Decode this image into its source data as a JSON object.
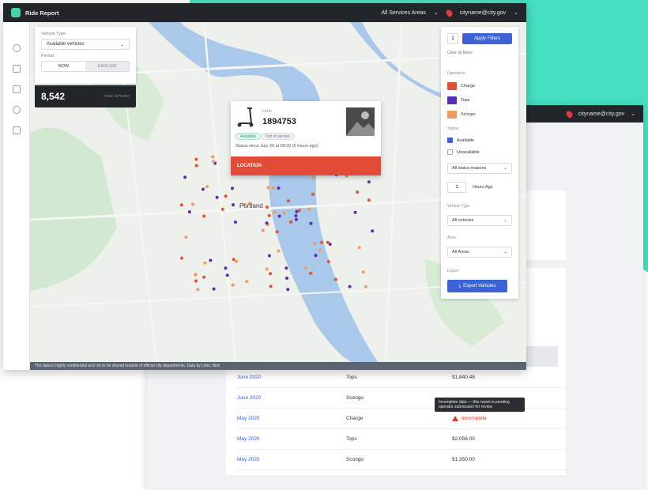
{
  "app": {
    "title": "Ride Report",
    "city_selector": "All Services Areas",
    "user_menu": "cityname@city.gov",
    "back_user_menu": "cityname@city.gov"
  },
  "filters": {
    "type_label": "Vehicle Type",
    "type_value": "Available vehicles",
    "period_label": "Period",
    "period_now": "NOW",
    "period_other": "EARLIER"
  },
  "count": {
    "value": "8,542",
    "caption": "total vehicles"
  },
  "popup": {
    "header": "Lime",
    "vehicle_id": "1894753",
    "chip_status": "Available",
    "chip_other": "Out of service",
    "meta": "Status since July 30 at 09:00 (5 hours ago)",
    "bar_text": "LOCATION"
  },
  "panel": {
    "count_input": "1",
    "apply_label": "Apply Filters",
    "clear_label": "Clear all filters",
    "operators_label": "Operators",
    "operators": [
      {
        "name": "Charge",
        "color": "#e0532e"
      },
      {
        "name": "Tops",
        "color": "#5b2db0"
      },
      {
        "name": "Scoogo",
        "color": "#f39a62"
      }
    ],
    "status_label": "Status",
    "status": [
      {
        "name": "Available",
        "checked": true
      },
      {
        "name": "Unavailable",
        "checked": false
      }
    ],
    "status_select": "All status reasons",
    "hours_value": "1",
    "hours_label": "Hours Ago",
    "vehicle_label": "Vehicle Type",
    "vehicle_select": "All vehicles",
    "area_label": "Area",
    "area_select": "All Areas",
    "export_label": "Export",
    "export_button": "Export Vehicles"
  },
  "map": {
    "city_label": "Portland",
    "footer": "The data is highly confidential and not to be shared outside of official city departments. Data by Lime, Bird"
  },
  "table": {
    "rows": [
      {
        "month": "June 2020",
        "operator": "Tops",
        "amount": "$1,840.48",
        "warn": false
      },
      {
        "month": "June 2020",
        "operator": "Scoogo",
        "amount": "",
        "warn": false
      },
      {
        "month": "May 2020",
        "operator": "Charge",
        "amount": "Incomplete",
        "warn": true
      },
      {
        "month": "May 2020",
        "operator": "Tops",
        "amount": "$2,056.00",
        "warn": false
      },
      {
        "month": "May 2020",
        "operator": "Scoogo",
        "amount": "$1,350.00",
        "warn": false
      }
    ],
    "tooltip": "Incomplete data — this report is pending operator submission for review"
  },
  "colors": {
    "teal": "#46dfc0",
    "dark": "#22262b",
    "blue": "#3b63d6",
    "red": "#e34b39",
    "orange": "#e0532e",
    "purple": "#5b2db0"
  }
}
